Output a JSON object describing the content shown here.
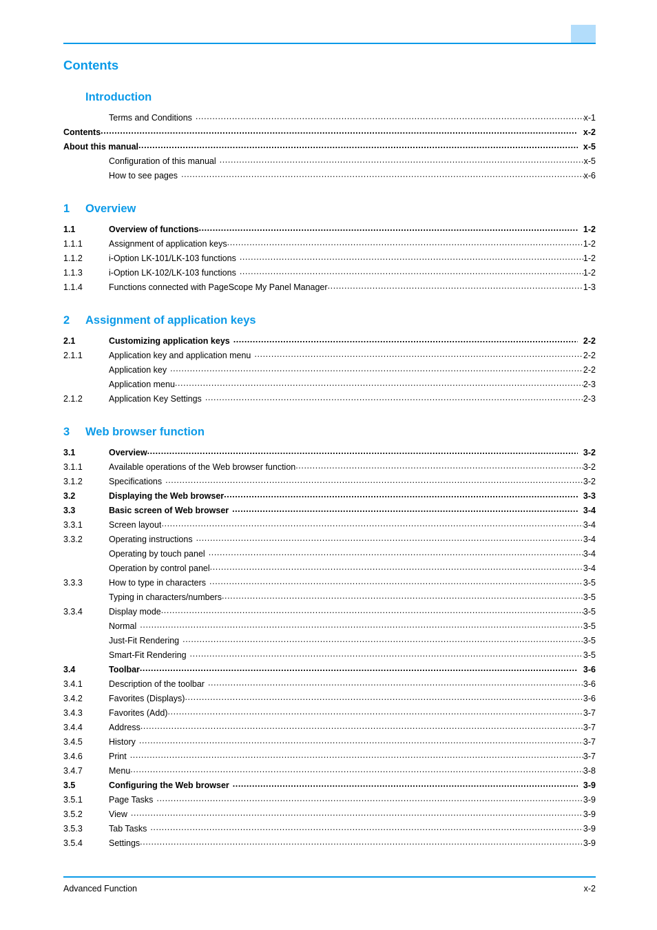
{
  "document": {
    "page_title": "Contents",
    "accent_color": "#0b9ae8",
    "tab_color": "#b3ddfb"
  },
  "footer": {
    "left_label": "Advanced Function",
    "page_number": "x-2"
  },
  "toc": {
    "sections": [
      {
        "kind": "part",
        "heading": "Introduction",
        "entries": [
          {
            "level": 3,
            "number": "",
            "title": "Terms and Conditions",
            "page": "x-1",
            "spaced": true
          },
          {
            "level": 2,
            "number": "",
            "title": "Contents",
            "page": "x-2",
            "spaced": false,
            "full_width_title": true
          },
          {
            "level": 2,
            "number": "",
            "title": "About this manual",
            "page": "x-5",
            "spaced": false,
            "full_width_title": true
          },
          {
            "level": 3,
            "number": "",
            "title": "Configuration of this manual",
            "page": "x-5",
            "spaced": true
          },
          {
            "level": 3,
            "number": "",
            "title": "How to see pages",
            "page": "x-6",
            "spaced": true
          }
        ]
      },
      {
        "kind": "chapter",
        "number": "1",
        "heading": "Overview",
        "entries": [
          {
            "level": 2,
            "number": "1.1",
            "title": "Overview of functions",
            "page": "1-2",
            "spaced": false
          },
          {
            "level": 3,
            "number": "1.1.1",
            "title": "Assignment of application keys",
            "page": "1-2",
            "spaced": false
          },
          {
            "level": 3,
            "number": "1.1.2",
            "title": "i-Option LK-101/LK-103 functions",
            "page": "1-2",
            "spaced": true
          },
          {
            "level": 3,
            "number": "1.1.3",
            "title": "i-Option LK-102/LK-103 functions",
            "page": "1-2",
            "spaced": true
          },
          {
            "level": 3,
            "number": "1.1.4",
            "title": "Functions connected with PageScope My Panel Manager",
            "page": "1-3",
            "spaced": false
          }
        ]
      },
      {
        "kind": "chapter",
        "number": "2",
        "heading": "Assignment of application keys",
        "entries": [
          {
            "level": 2,
            "number": "2.1",
            "title": "Customizing application keys",
            "page": "2-2",
            "spaced": true
          },
          {
            "level": 3,
            "number": "2.1.1",
            "title": "Application key and application menu",
            "page": "2-2",
            "spaced": true
          },
          {
            "level": 4,
            "number": "",
            "title": "Application key",
            "page": "2-2",
            "spaced": true
          },
          {
            "level": 4,
            "number": "",
            "title": "Application menu",
            "page": "2-3",
            "spaced": false
          },
          {
            "level": 3,
            "number": "2.1.2",
            "title": "Application Key Settings",
            "page": "2-3",
            "spaced": true
          }
        ]
      },
      {
        "kind": "chapter",
        "number": "3",
        "heading": "Web browser function",
        "entries": [
          {
            "level": 2,
            "number": "3.1",
            "title": "Overview",
            "page": "3-2",
            "spaced": false
          },
          {
            "level": 3,
            "number": "3.1.1",
            "title": "Available operations of the Web browser function",
            "page": "3-2",
            "spaced": false
          },
          {
            "level": 3,
            "number": "3.1.2",
            "title": "Specifications",
            "page": "3-2",
            "spaced": true
          },
          {
            "level": 2,
            "number": "3.2",
            "title": "Displaying the Web browser",
            "page": "3-3",
            "spaced": false
          },
          {
            "level": 2,
            "number": "3.3",
            "title": "Basic screen of Web browser",
            "page": "3-4",
            "spaced": true
          },
          {
            "level": 3,
            "number": "3.3.1",
            "title": "Screen layout",
            "page": "3-4",
            "spaced": false
          },
          {
            "level": 3,
            "number": "3.3.2",
            "title": "Operating instructions",
            "page": "3-4",
            "spaced": true
          },
          {
            "level": 4,
            "number": "",
            "title": "Operating by touch panel",
            "page": "3-4",
            "spaced": true
          },
          {
            "level": 4,
            "number": "",
            "title": "Operation by control panel",
            "page": "3-4",
            "spaced": false
          },
          {
            "level": 3,
            "number": "3.3.3",
            "title": "How to type in characters",
            "page": "3-5",
            "spaced": true
          },
          {
            "level": 4,
            "number": "",
            "title": "Typing in characters/numbers",
            "page": "3-5",
            "spaced": false
          },
          {
            "level": 3,
            "number": "3.3.4",
            "title": "Display mode",
            "page": "3-5",
            "spaced": false
          },
          {
            "level": 4,
            "number": "",
            "title": "Normal",
            "page": "3-5",
            "spaced": true
          },
          {
            "level": 4,
            "number": "",
            "title": "Just-Fit Rendering",
            "page": "3-5",
            "spaced": true
          },
          {
            "level": 4,
            "number": "",
            "title": "Smart-Fit Rendering",
            "page": "3-5",
            "spaced": true
          },
          {
            "level": 2,
            "number": "3.4",
            "title": "Toolbar",
            "page": "3-6",
            "spaced": false
          },
          {
            "level": 3,
            "number": "3.4.1",
            "title": "Description of the toolbar",
            "page": "3-6",
            "spaced": true
          },
          {
            "level": 3,
            "number": "3.4.2",
            "title": "Favorites (Displays)",
            "page": "3-6",
            "spaced": false
          },
          {
            "level": 3,
            "number": "3.4.3",
            "title": "Favorites (Add)",
            "page": "3-7",
            "spaced": false
          },
          {
            "level": 3,
            "number": "3.4.4",
            "title": "Address",
            "page": "3-7",
            "spaced": false
          },
          {
            "level": 3,
            "number": "3.4.5",
            "title": "History",
            "page": "3-7",
            "spaced": true
          },
          {
            "level": 3,
            "number": "3.4.6",
            "title": "Print",
            "page": "3-7",
            "spaced": true
          },
          {
            "level": 3,
            "number": "3.4.7",
            "title": "Menu",
            "page": "3-8",
            "spaced": false
          },
          {
            "level": 2,
            "number": "3.5",
            "title": "Configuring the Web browser",
            "page": "3-9",
            "spaced": true
          },
          {
            "level": 3,
            "number": "3.5.1",
            "title": "Page Tasks",
            "page": "3-9",
            "spaced": true
          },
          {
            "level": 3,
            "number": "3.5.2",
            "title": "View",
            "page": "3-9",
            "spaced": true
          },
          {
            "level": 3,
            "number": "3.5.3",
            "title": "Tab Tasks",
            "page": "3-9",
            "spaced": true
          },
          {
            "level": 3,
            "number": "3.5.4",
            "title": "Settings",
            "page": "3-9",
            "spaced": false
          }
        ]
      }
    ]
  }
}
